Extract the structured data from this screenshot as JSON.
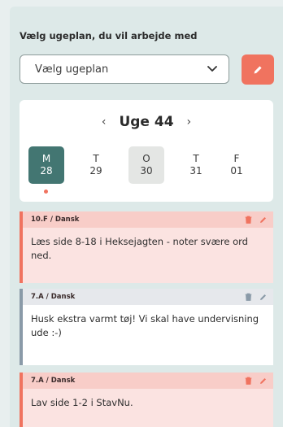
{
  "plan_selector": {
    "heading": "Vælg ugeplan, du vil arbejde med",
    "select_value": "Vælg ugeplan"
  },
  "week": {
    "title": "Uge 44",
    "prev_icon": "chevron-left-icon",
    "next_icon": "chevron-right-icon",
    "days": [
      {
        "letter": "M",
        "date": "28",
        "state": "selected"
      },
      {
        "letter": "T",
        "date": "29",
        "state": "normal"
      },
      {
        "letter": "O",
        "date": "30",
        "state": "today"
      },
      {
        "letter": "T",
        "date": "31",
        "state": "normal"
      },
      {
        "letter": "F",
        "date": "01",
        "state": "normal"
      }
    ]
  },
  "notes": [
    {
      "header": "10.F / Dansk",
      "text": "Læs side 8-18 i Heksejagten - noter svære ord ned.",
      "color": "#f0735f"
    },
    {
      "header": "7.A / Dansk",
      "text": "Husk ekstra varmt tøj! Vi skal have undervisning ude :-)",
      "color": "#8a9aa8"
    },
    {
      "header": "7.A / Dansk",
      "text": "Lav side 1-2 i StavNu.",
      "color": "#f0735f"
    }
  ],
  "colors": {
    "accent": "#f0735f",
    "selected_day": "#437672",
    "panel": "#dde9e8"
  }
}
